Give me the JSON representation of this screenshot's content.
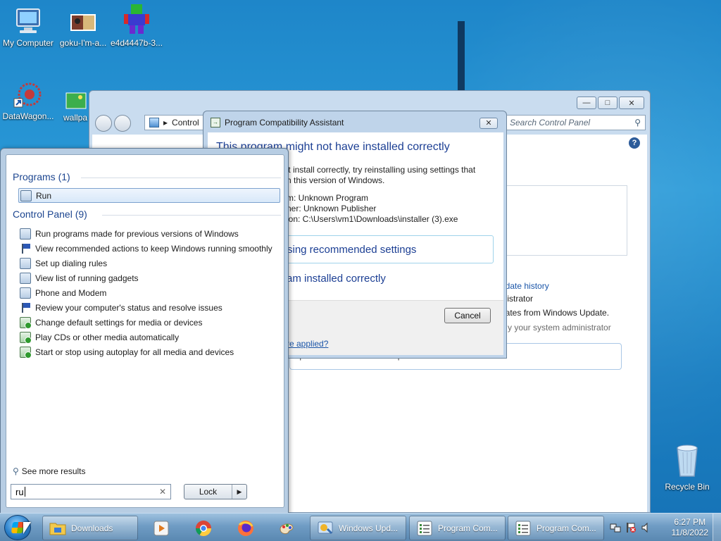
{
  "desktop": {
    "icons": [
      {
        "label": "My Computer",
        "icon": "computer-icon"
      },
      {
        "label": "goku-I'm-a...",
        "icon": "image-file-icon"
      },
      {
        "label": "e4d4447b-3...",
        "icon": "app-file-icon"
      },
      {
        "label": "DataWagon...",
        "icon": "shortcut-icon"
      },
      {
        "label": "wallpa",
        "icon": "image-file-icon"
      },
      {
        "label": "Recycle Bin",
        "icon": "recycle-bin-icon"
      }
    ]
  },
  "windows_update": {
    "address": "Control",
    "search_placeholder": "Search Control Panel",
    "lines": [
      "pdate history",
      "inistrator",
      "dates from Windows Update.",
      "y your system administrator",
      "t updates for other Microsoft products. Find out more"
    ]
  },
  "pca_dialog": {
    "title": "Program Compatibility Assistant",
    "heading": "This program might not have installed correctly",
    "body_line1": "'t install correctly, try reinstalling using settings that",
    "body_line2": "h this version of Windows.",
    "program": "m: Unknown Program",
    "publisher": "ner: Unknown Publisher",
    "location": "ion: C:\\Users\\vm1\\Downloads\\installer (3).exe",
    "option_recommended": "sing recommended settings",
    "option_installed": "am installed correctly",
    "cancel_label": "Cancel",
    "link_text": "re applied?"
  },
  "start_menu": {
    "programs_header": "Programs (1)",
    "programs": [
      {
        "label": "Run",
        "icon": "run-icon"
      }
    ],
    "control_panel_header": "Control Panel (9)",
    "control_panel_items": [
      {
        "label": "Run programs made for previous versions of Windows",
        "icon": "compatibility-icon"
      },
      {
        "label": "View recommended actions to keep Windows running smoothly",
        "icon": "flag-icon"
      },
      {
        "label": "Set up dialing rules",
        "icon": "phone-icon"
      },
      {
        "label": "View list of running gadgets",
        "icon": "gadgets-icon"
      },
      {
        "label": "Phone and Modem",
        "icon": "modem-icon"
      },
      {
        "label": "Review your computer's status and resolve issues",
        "icon": "flag-icon"
      },
      {
        "label": "Change default settings for media or devices",
        "icon": "autoplay-icon"
      },
      {
        "label": "Play CDs or other media automatically",
        "icon": "autoplay-icon"
      },
      {
        "label": "Start or stop using autoplay for all media and devices",
        "icon": "autoplay-icon"
      }
    ],
    "see_more": "See more results",
    "search_value": "ru",
    "lock_label": "Lock"
  },
  "taskbar": {
    "downloads_label": "Downloads",
    "windows_update_label": "Windows Upd...",
    "program_com_1": "Program Com...",
    "program_com_2": "Program Com...",
    "time": "6:27 PM",
    "date": "11/8/2022"
  },
  "colors": {
    "accent": "#1c3f94",
    "link": "#1a55a8",
    "desktop": "#1e86c9"
  }
}
